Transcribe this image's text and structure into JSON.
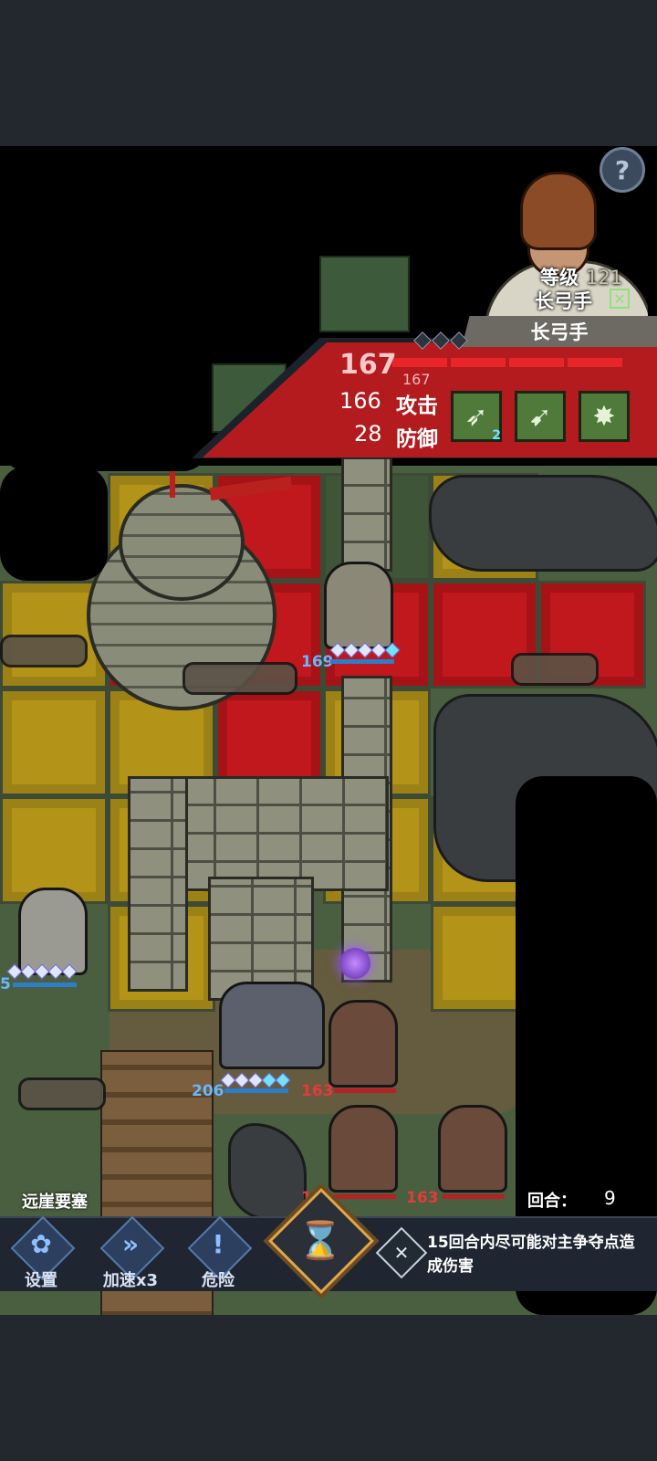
{
  "hud": {
    "help_glyph": "?",
    "map_name": "远崖要塞",
    "round_label": "回合：",
    "round_value": "9",
    "objective_text": "15回合内尽可能对主争夺点造成伤害",
    "buttons": [
      {
        "label": "设置",
        "icon": "gear-icon",
        "glyph": "✿"
      },
      {
        "label": "加速x3",
        "icon": "fast-forward-icon",
        "glyph": "»"
      },
      {
        "label": "危险",
        "icon": "exclamation-icon",
        "glyph": "!"
      }
    ],
    "end_turn_icon": "hourglass-icon",
    "end_turn_glyph": "⌛",
    "objective_icon": "crossed-swords-icon",
    "objective_glyph": "✕"
  },
  "selected_unit": {
    "level_label": "等级",
    "level_value": "121",
    "class_name": "长弓手",
    "name_banner": "长弓手",
    "hp_current": "167",
    "hp_max": "167",
    "attack_value": "166",
    "attack_label": "攻击",
    "defense_value": "28",
    "defense_label": "防御",
    "skills": [
      {
        "icon": "bow-shot-icon",
        "badge": "2"
      },
      {
        "icon": "bow-slash-icon",
        "badge": ""
      },
      {
        "icon": "explosion-target-icon",
        "badge": ""
      }
    ]
  },
  "units": {
    "archer_hp": "169",
    "statue_hp": "5",
    "knight_hp": "206",
    "enemy_hp": "163",
    "enemy2_hp": "190",
    "enemy3_hp": "163"
  },
  "colors": {
    "danger_tile": "#c0181c",
    "move_tile": "#b39418",
    "panel_red": "#b31b1e",
    "ally_hp": "#67b7ff",
    "enemy_hp": "#e6393c"
  }
}
